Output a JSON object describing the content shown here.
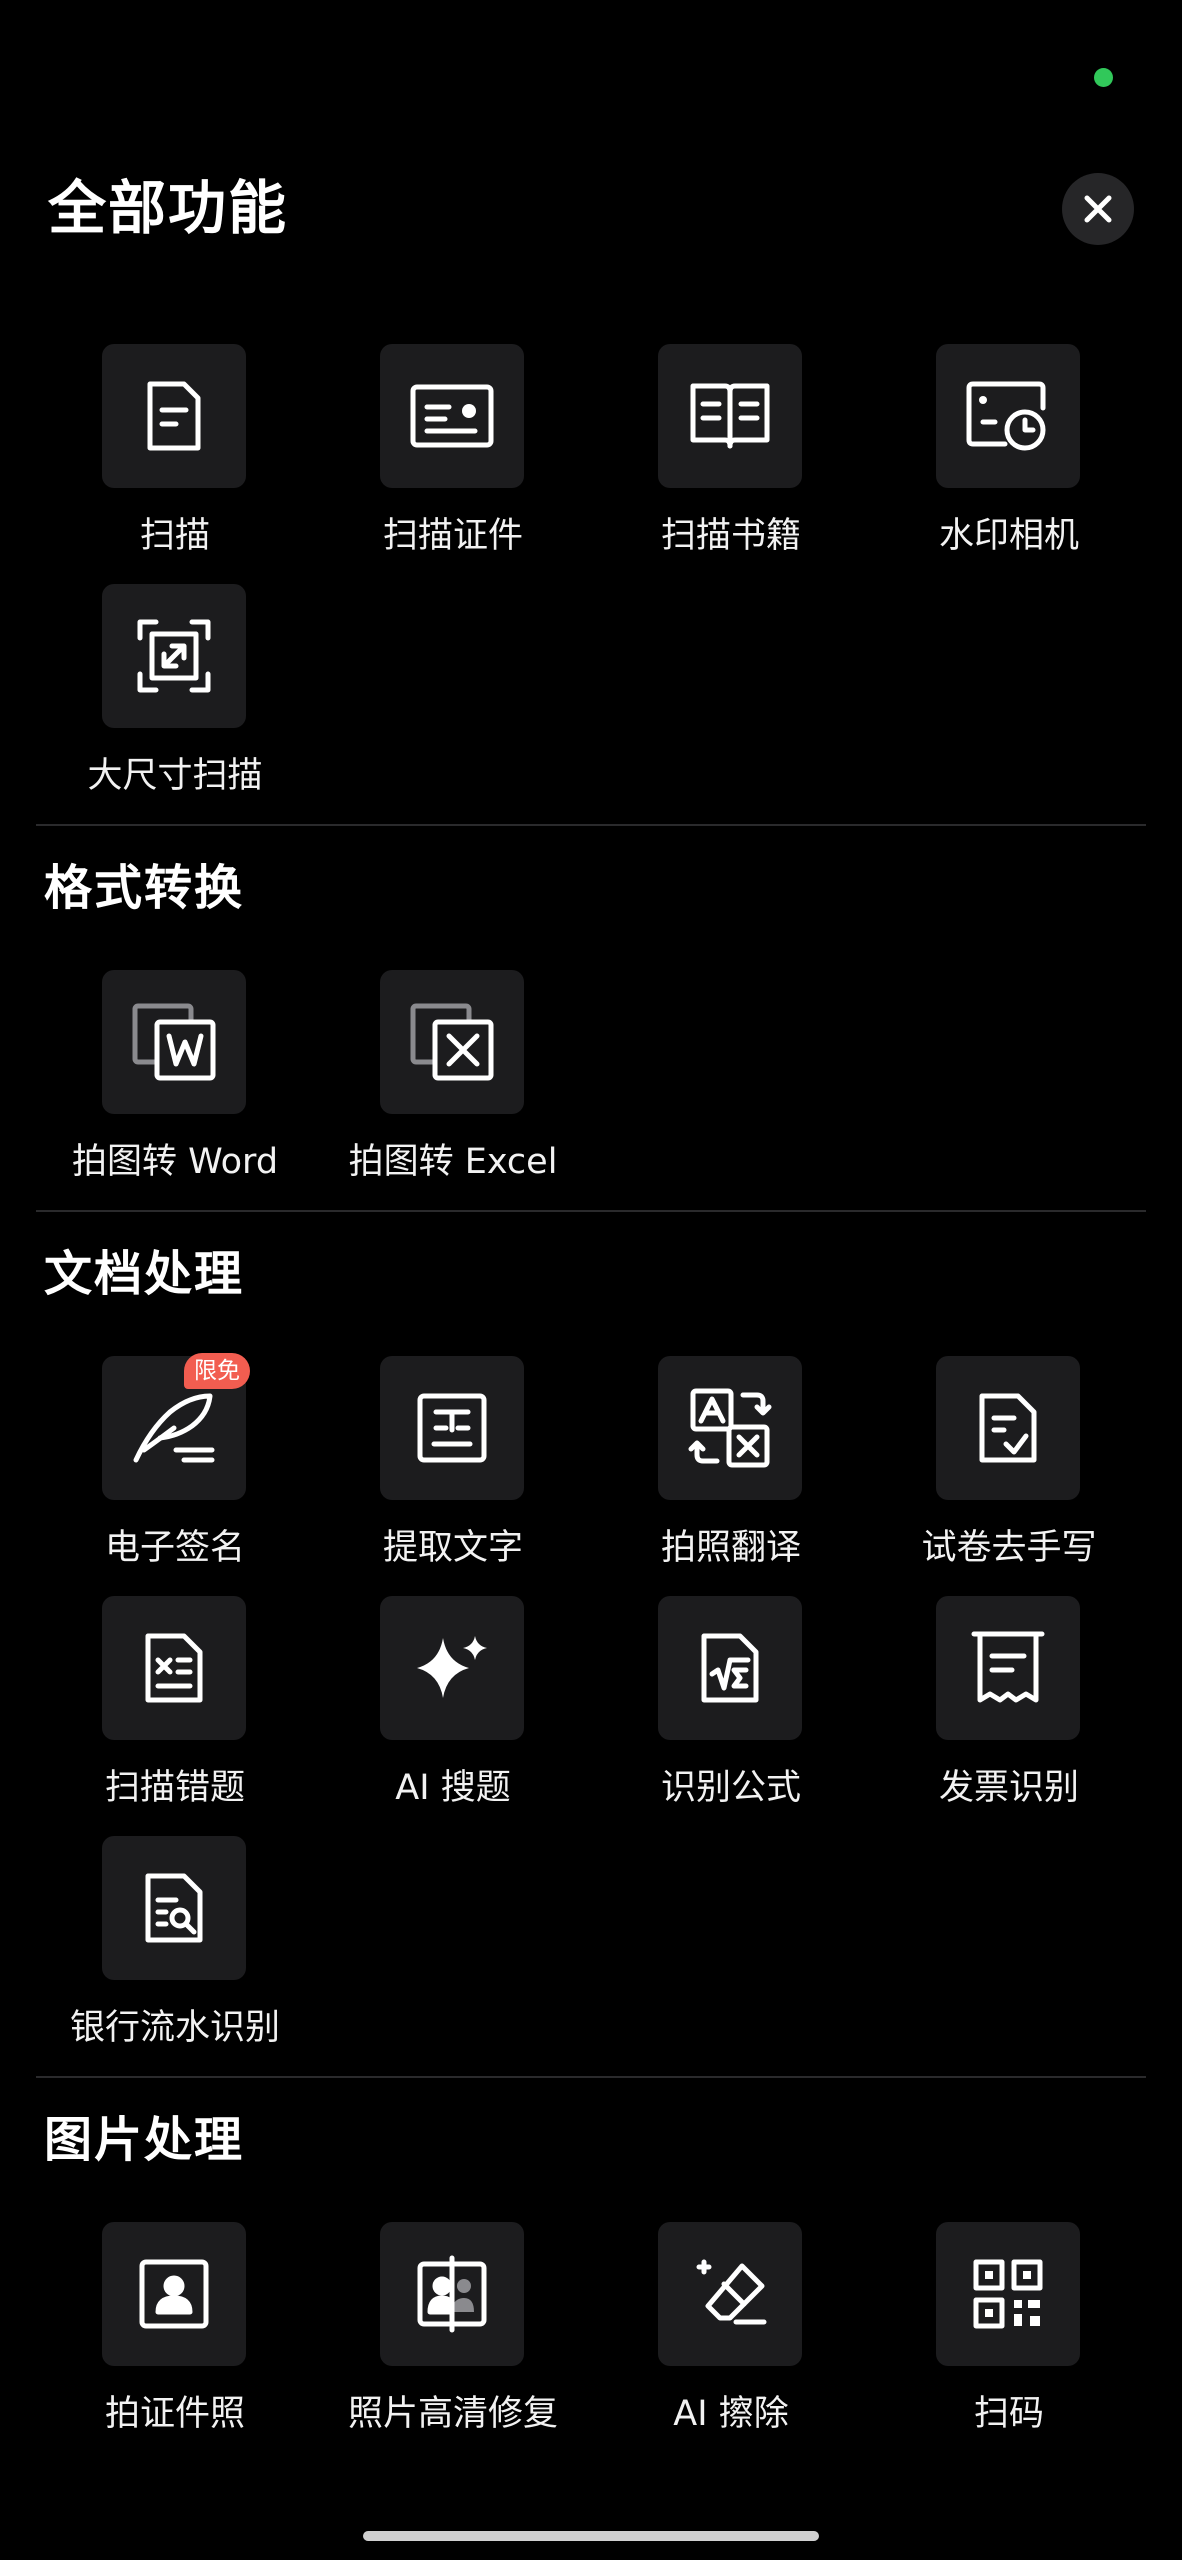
{
  "header": {
    "title": "全部功能",
    "close_icon": "close-icon"
  },
  "sections": {
    "scan": {
      "tools": [
        {
          "label": "扫描",
          "icon": "document-icon"
        },
        {
          "label": "扫描证件",
          "icon": "id-card-icon"
        },
        {
          "label": "扫描书籍",
          "icon": "book-icon"
        },
        {
          "label": "水印相机",
          "icon": "watermark-camera-icon"
        },
        {
          "label": "大尺寸扫描",
          "icon": "expand-scan-icon"
        }
      ]
    },
    "format": {
      "title": "格式转换",
      "tools": [
        {
          "label": "拍图转 Word",
          "icon": "word-icon"
        },
        {
          "label": "拍图转 Excel",
          "icon": "excel-icon"
        }
      ]
    },
    "doc": {
      "title": "文档处理",
      "tools": [
        {
          "label": "电子签名",
          "icon": "signature-icon",
          "badge": "限免"
        },
        {
          "label": "提取文字",
          "icon": "extract-text-icon"
        },
        {
          "label": "拍照翻译",
          "icon": "translate-icon"
        },
        {
          "label": "试卷去手写",
          "icon": "paper-check-icon"
        },
        {
          "label": "扫描错题",
          "icon": "wrong-question-icon"
        },
        {
          "label": "AI 搜题",
          "icon": "sparkle-icon"
        },
        {
          "label": "识别公式",
          "icon": "formula-icon"
        },
        {
          "label": "发票识别",
          "icon": "invoice-icon"
        },
        {
          "label": "银行流水识别",
          "icon": "bank-statement-icon"
        }
      ]
    },
    "image": {
      "title": "图片处理",
      "tools": [
        {
          "label": "拍证件照",
          "icon": "id-photo-icon"
        },
        {
          "label": "照片高清修复",
          "icon": "photo-restore-icon"
        },
        {
          "label": "AI 擦除",
          "icon": "eraser-icon"
        },
        {
          "label": "扫码",
          "icon": "qr-code-icon"
        }
      ]
    }
  },
  "colors": {
    "background": "#000000",
    "tile": "#1c1c1e",
    "badge": "#f25d50",
    "status_dot": "#31c85a"
  }
}
